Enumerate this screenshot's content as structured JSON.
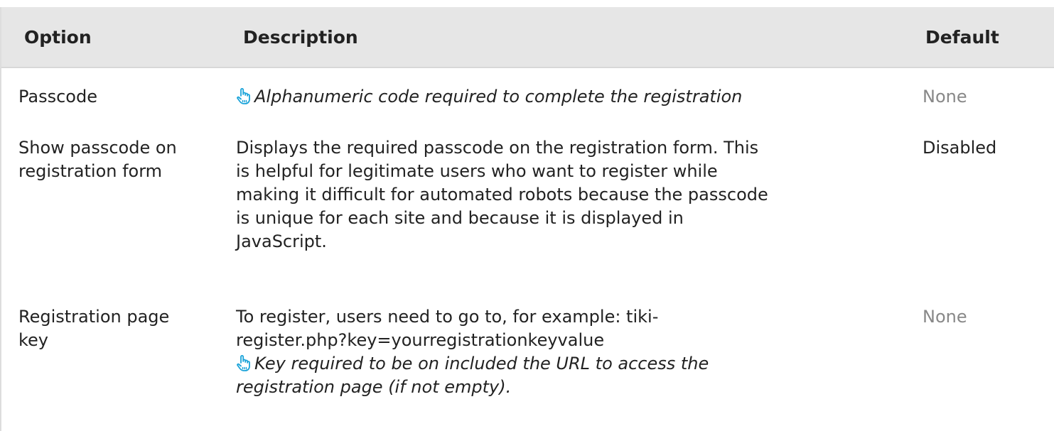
{
  "table": {
    "headers": {
      "option": "Option",
      "description": "Description",
      "default": "Default"
    },
    "rows": [
      {
        "option": "Passcode",
        "description": "",
        "tip": "Alphanumeric code required to complete the registration",
        "default": "None"
      },
      {
        "option_line1": "Show passcode on",
        "option_line2": "registration form",
        "description_lines": [
          "Displays the required passcode on the registration form. This",
          "is helpful for legitimate users who want to register while",
          "making it difficult for automated robots because the passcode",
          "is unique for each site and because it is displayed in",
          "JavaScript."
        ],
        "default": "Disabled"
      },
      {
        "option_line1": "Registration page",
        "option_line2": "key",
        "description_lines": [
          "To register, users need to go to, for example: tiki-",
          "register.php?key=yourregistrationkeyvalue"
        ],
        "tip_lines": [
          "Key required to be on included the URL to access the",
          "registration page (if not empty)."
        ],
        "default": "None"
      }
    ]
  },
  "icons": {
    "tip": "pointing-hand-icon",
    "tip_color": "#1aa3d9"
  }
}
